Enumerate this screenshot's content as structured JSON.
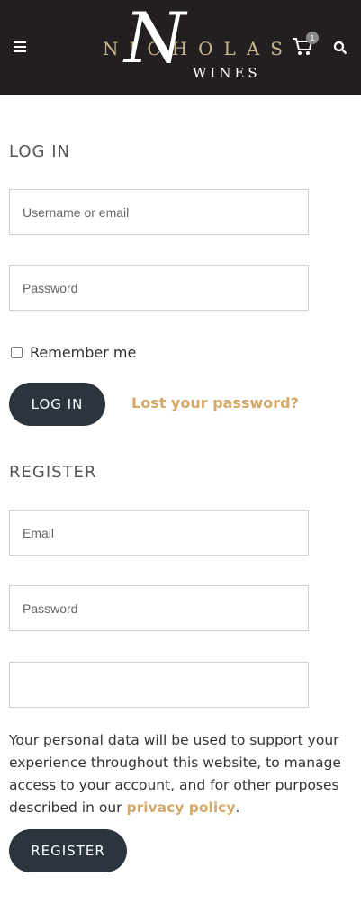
{
  "header": {
    "logo_top": "NICHOLAS",
    "logo_bottom": "WINES",
    "logo_letter": "N",
    "cart_count": "1"
  },
  "login": {
    "title": "LOG IN",
    "username_placeholder": "Username or email",
    "password_placeholder": "Password",
    "remember_label": "Remember me",
    "button_label": "LOG IN",
    "lost_password": "Lost your password?"
  },
  "register": {
    "title": "REGISTER",
    "email_placeholder": "Email",
    "password_placeholder": "Password",
    "privacy_text": "Your personal data will be used to support your experience throughout this website, to manage access to your account, and for other purposes described in our",
    "privacy_link": "privacy policy",
    "privacy_end": ".",
    "button_label": "REGISTER"
  },
  "colors": {
    "header_bg": "#231f20",
    "accent": "#d4a96a",
    "button_bg": "#2c353d"
  }
}
